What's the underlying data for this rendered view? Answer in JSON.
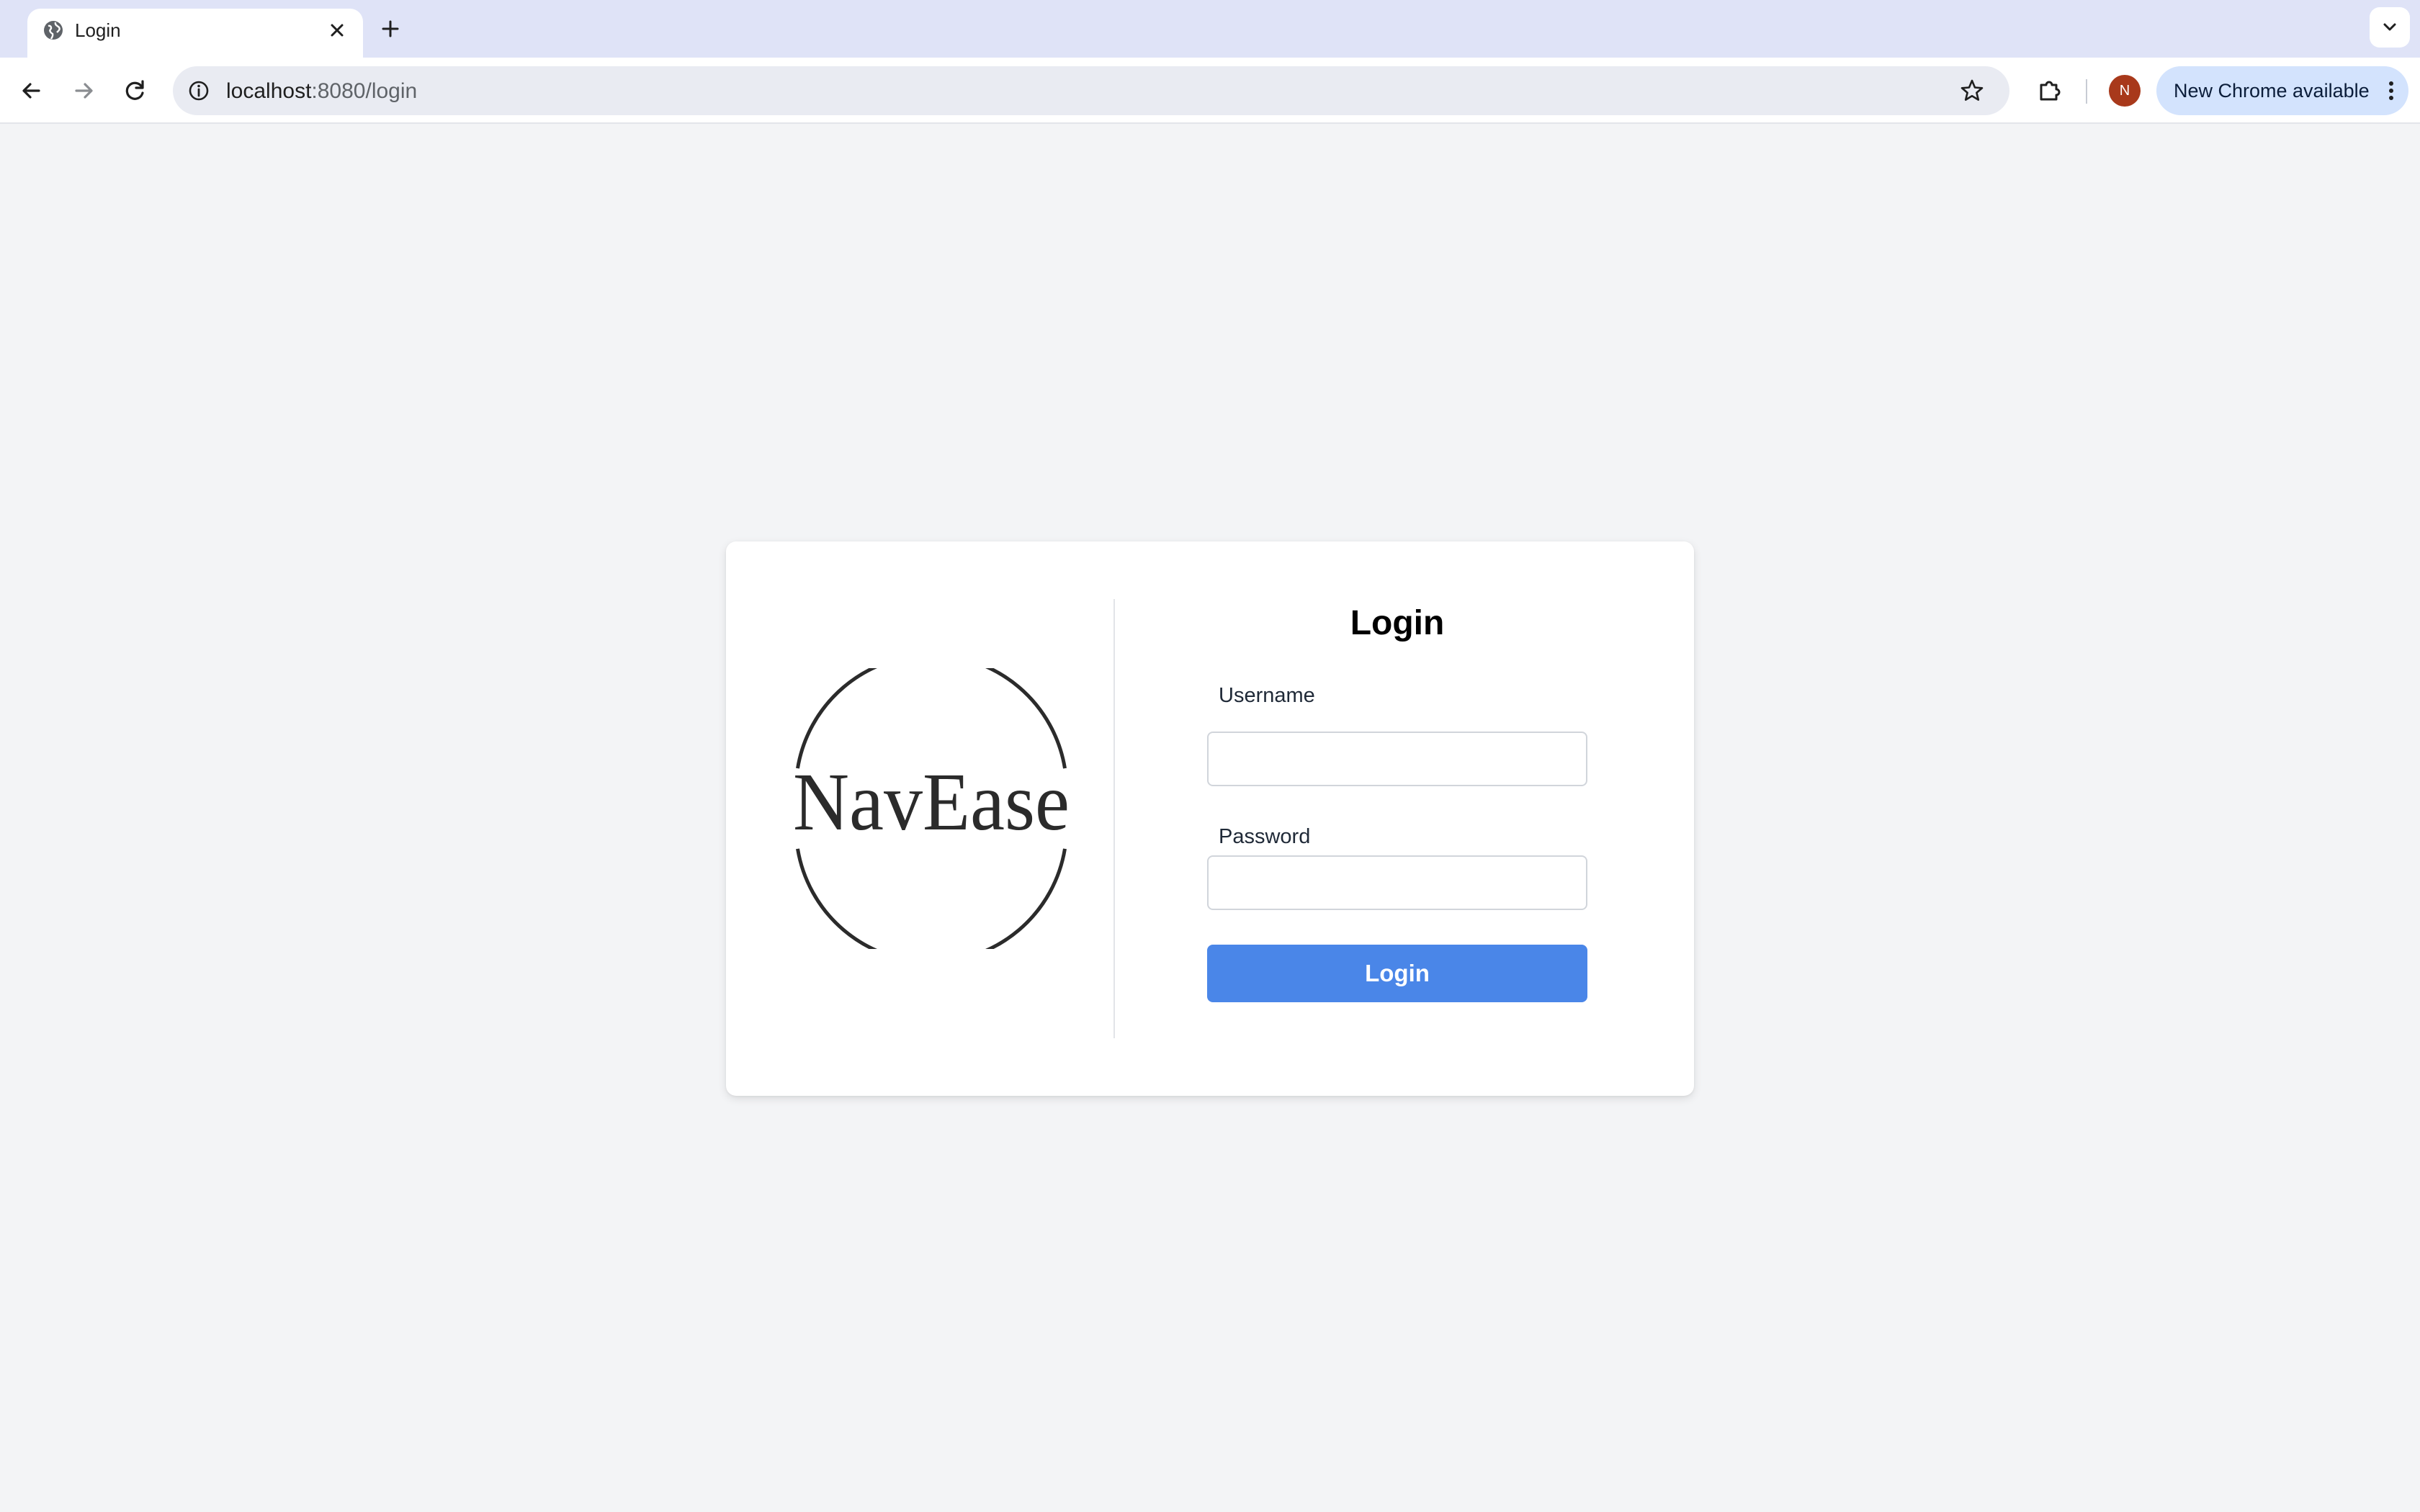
{
  "browser": {
    "tab": {
      "title": "Login"
    },
    "address_bar": {
      "host": "localhost",
      "path": ":8080/login"
    },
    "profile": {
      "initial": "N"
    },
    "update_chip": {
      "label": "New Chrome available"
    }
  },
  "page": {
    "logo": {
      "text": "NavEase"
    },
    "form": {
      "title": "Login",
      "username": {
        "label": "Username",
        "value": "",
        "placeholder": ""
      },
      "password": {
        "label": "Password",
        "value": "",
        "placeholder": ""
      },
      "submit_label": "Login"
    }
  },
  "colors": {
    "background": "#f3f4f6",
    "button": "#4a86e8",
    "avatar": "#a8391b",
    "tabstrip": "#dfe3f7"
  }
}
